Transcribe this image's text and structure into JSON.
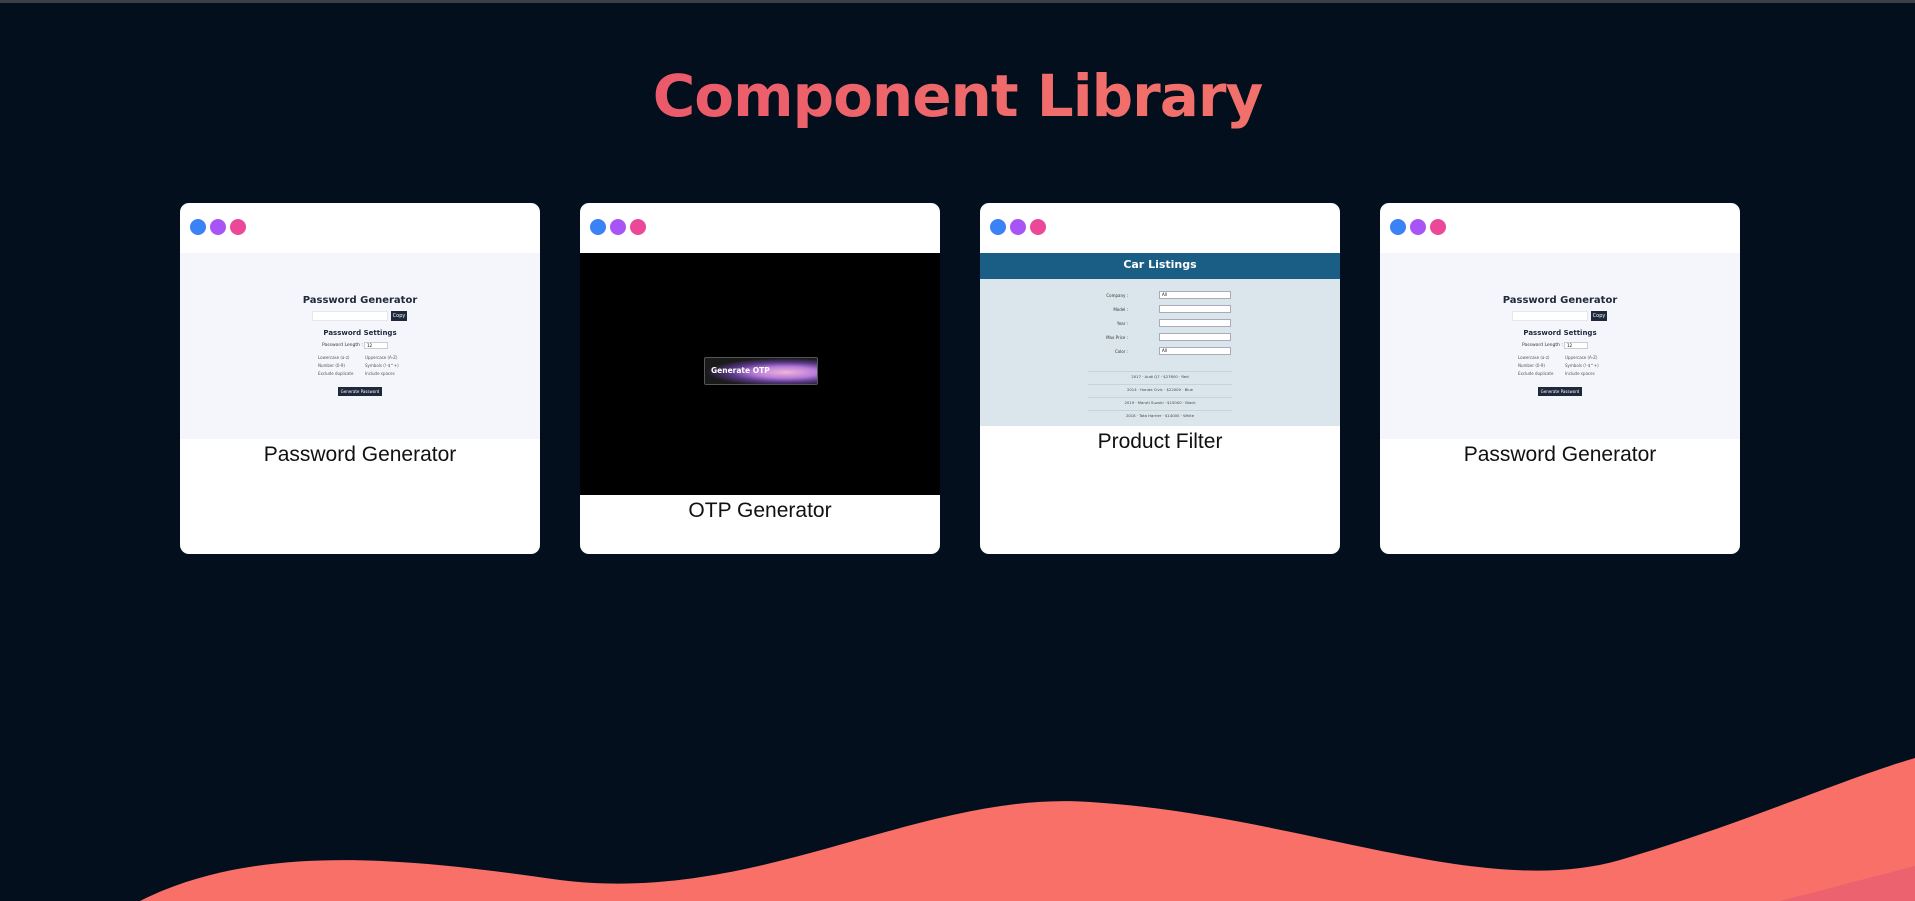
{
  "page": {
    "title": "Component Library"
  },
  "cards": [
    {
      "label": "Password Generator",
      "preview": {
        "heading": "Password Generator",
        "copy": "Copy",
        "settings": "Password Settings",
        "length_label": "Password Length :",
        "length_value": "12",
        "options": [
          "Lowercase (a-z)",
          "Uppercase (A-Z)",
          "Number (0-9)",
          "Symbols (!-$^+)",
          "Exclude duplicate",
          "Include spaces"
        ],
        "generate": "Generate Password"
      }
    },
    {
      "label": "OTP Generator",
      "preview": {
        "button": "Generate OTP"
      }
    },
    {
      "label": "Product Filter",
      "preview": {
        "heading": "Car Listings",
        "fields": [
          {
            "label": "Company :",
            "value": "All"
          },
          {
            "label": "Model :",
            "value": ""
          },
          {
            "label": "Year :",
            "value": ""
          },
          {
            "label": "Max Price :",
            "value": ""
          },
          {
            "label": "Color :",
            "value": "All"
          }
        ],
        "results": [
          "2017 · Audi Q7 · $27600 · Red",
          "2014 · Honda Civic · $22000 · Blue",
          "2019 · Maruti Suzuki · $15000 · Black",
          "2018 · Tata Harrier · $14000 · White"
        ]
      }
    },
    {
      "label": "Password Generator",
      "preview": {
        "heading": "Password Generator",
        "copy": "Copy",
        "settings": "Password Settings",
        "length_label": "Password Length :",
        "length_value": "12",
        "options": [
          "Lowercase (a-z)",
          "Uppercase (A-Z)",
          "Number (0-9)",
          "Symbols (!-$^+)",
          "Exclude duplicate",
          "Include spaces"
        ],
        "generate": "Generate Password"
      }
    }
  ],
  "colors": {
    "background": "#030f1d",
    "wave": "#f87068",
    "dot_blue": "#3b82f6",
    "dot_purple": "#a855f7",
    "dot_pink": "#ec4899"
  }
}
